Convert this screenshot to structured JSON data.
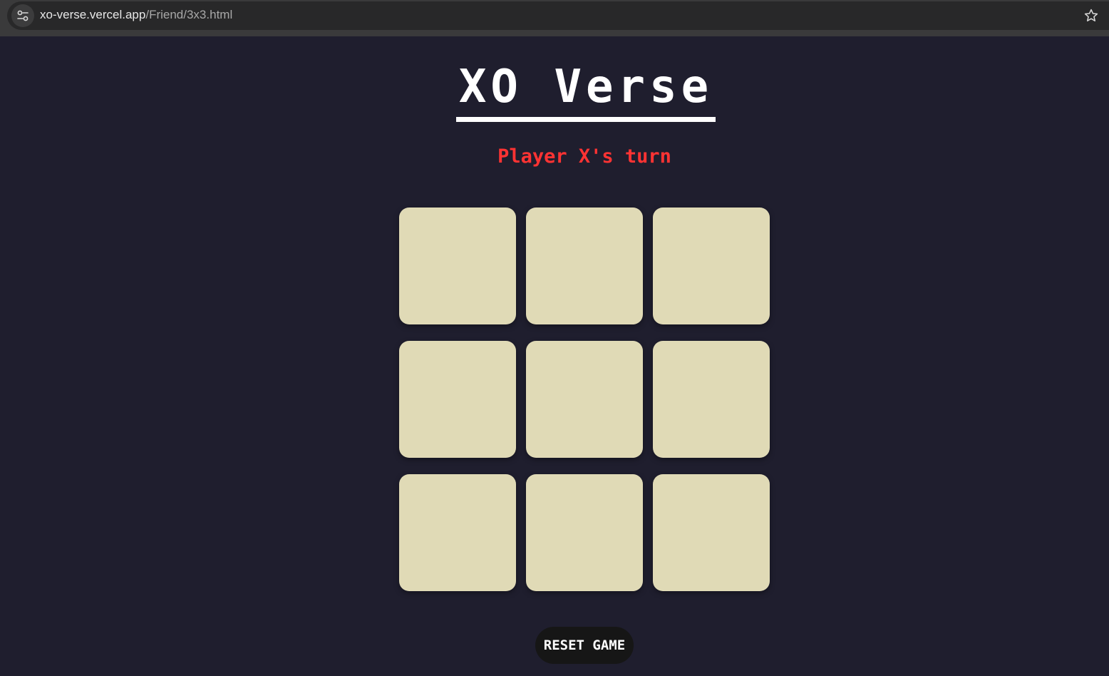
{
  "browser": {
    "url_host": "xo-verse.vercel.app",
    "url_path": "/Friend/3x3.html",
    "site_info_icon": "tune-icon",
    "bookmark_icon": "star-outline-icon"
  },
  "page": {
    "title": "XO Verse",
    "turn_status": "Player X's turn",
    "board": {
      "rows": 3,
      "cols": 3,
      "cells": [
        "",
        "",
        "",
        "",
        "",
        "",
        "",
        "",
        ""
      ]
    },
    "reset_label": "RESET GAME"
  },
  "colors": {
    "background": "#1f1e2e",
    "title": "#ffffff",
    "turn_status": "#ff3333",
    "cell": "#e0dab6",
    "reset_button": "#161616"
  }
}
